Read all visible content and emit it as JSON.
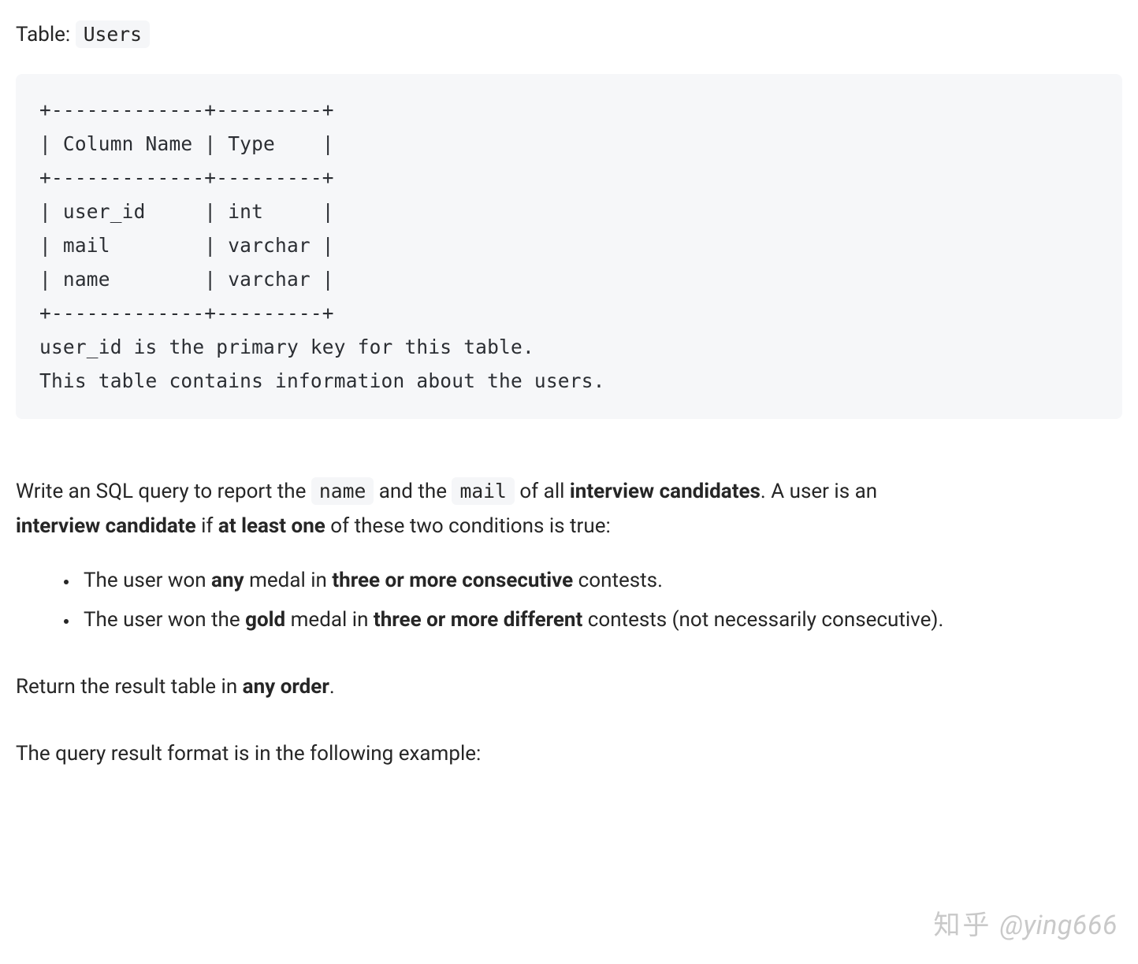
{
  "intro": {
    "prefix": "Table: ",
    "tableName": "Users"
  },
  "codeBlock": "+-------------+---------+\n| Column Name | Type    |\n+-------------+---------+\n| user_id     | int     |\n| mail        | varchar |\n| name        | varchar |\n+-------------+---------+\nuser_id is the primary key for this table.\nThis table contains information about the users.",
  "prompt": {
    "p1_span1": "Write an SQL query to report the ",
    "code1": "name",
    "p1_span2": " and the ",
    "code2": "mail",
    "p1_span3": " of all ",
    "p1_bold1": "interview candidates",
    "p1_span4": ". A user is an ",
    "p1_bold2": "interview candidate",
    "p1_span5": " if ",
    "p1_bold3": "at least one",
    "p1_span6": " of these two conditions is true:"
  },
  "bullets": {
    "b1": {
      "s1": "The user won ",
      "bold1": "any",
      "s2": " medal in ",
      "bold2": "three or more consecutive",
      "s3": " contests."
    },
    "b2": {
      "s1": "The user won the ",
      "bold1": "gold",
      "s2": " medal in ",
      "bold2": "three or more different",
      "s3": " contests (not necessarily consecutive)."
    }
  },
  "returnLine": {
    "s1": "Return the result table in ",
    "bold": "any order",
    "s2": "."
  },
  "formatLine": "The query result format is in the following example:",
  "watermark": {
    "brand": "知乎",
    "handle": "@ying666"
  }
}
